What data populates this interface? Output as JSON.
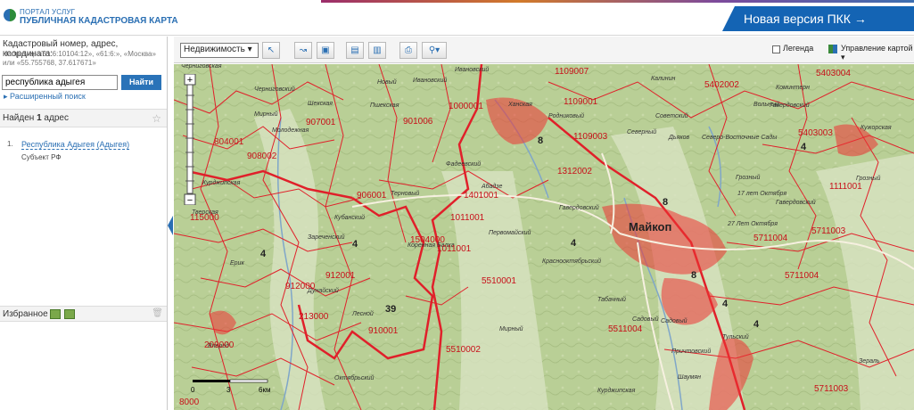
{
  "header": {
    "brand_top": "ПОРТАЛ УСЛУГ",
    "brand_main": "ПУБЛИЧНАЯ КАДАСТРОВАЯ КАРТА",
    "new_version": "Новая версия ПКК →"
  },
  "sidebar": {
    "hint_title": "Кадастровый номер, адрес, координата:",
    "hint_sub": "Например «61:6:10104:12», «61:6:», «Москва» или «55.755768, 37.617671»",
    "search_value": "республика адыгея",
    "search_button": "Найти",
    "advanced": "Расширенный поиск",
    "found_prefix": "Найден ",
    "found_count": "1",
    "found_suffix": " адрес",
    "result_num": "1.",
    "result_link": "Республика Адыгея (Адыгея)",
    "result_type": "Субъект РФ",
    "favorites": "Избранное"
  },
  "toolbar": {
    "select": "Недвижимость",
    "legend": "Легенда",
    "manage": "Управление картой"
  },
  "map": {
    "city": "Майкоп",
    "scale": [
      "0",
      "3",
      "6км"
    ],
    "labels": [
      {
        "t": "Черниговская"
      },
      {
        "t": "Новый"
      },
      {
        "t": "Ивановский"
      },
      {
        "t": "Ивановский"
      },
      {
        "t": "Черниговский"
      },
      {
        "t": "Шекская"
      },
      {
        "t": "Пшекская"
      },
      {
        "t": "Мирный"
      },
      {
        "t": "Молодежная"
      },
      {
        "t": "Ханская"
      },
      {
        "t": "Родниковый"
      },
      {
        "t": "Калинин"
      },
      {
        "t": "Гавердовский"
      },
      {
        "t": "Коминтерн"
      },
      {
        "t": "Вольный"
      },
      {
        "t": "Северный"
      },
      {
        "t": "Советский"
      },
      {
        "t": "Дьяков"
      },
      {
        "t": "Северо-Восточные Сады"
      },
      {
        "t": "Грозный"
      },
      {
        "t": "Фадеевский"
      },
      {
        "t": "Абадзе"
      },
      {
        "t": "Терновый"
      },
      {
        "t": "Кубанский"
      },
      {
        "t": "Гавердовский"
      },
      {
        "t": "Зареченский"
      },
      {
        "t": "Тверская"
      },
      {
        "t": "Курджипская"
      },
      {
        "t": "Коренная Балка"
      },
      {
        "t": "Первомайский"
      },
      {
        "t": "Краснооктябрьский"
      },
      {
        "t": "27 Лет Октября"
      },
      {
        "t": "17 лет Октября"
      },
      {
        "t": "Гавердовский"
      },
      {
        "t": "Ерик"
      },
      {
        "t": "Дунайский"
      },
      {
        "t": "Лесной"
      },
      {
        "t": "Табачный"
      },
      {
        "t": "Мирный"
      },
      {
        "t": "Садовый"
      },
      {
        "t": "Садовый"
      },
      {
        "t": "Тульский"
      },
      {
        "t": "Причтовский"
      },
      {
        "t": "Шаумян"
      },
      {
        "t": "Вперед"
      },
      {
        "t": "Октябрьский"
      },
      {
        "t": "Курджипская"
      },
      {
        "t": "Кужорская"
      },
      {
        "t": "Зераль"
      },
      {
        "t": "Грозный"
      }
    ],
    "parcels": [
      {
        "t": "1109007"
      },
      {
        "t": "5402002"
      },
      {
        "t": "5403004"
      },
      {
        "t": "1109001"
      },
      {
        "t": "1109003"
      },
      {
        "t": "901006"
      },
      {
        "t": "1000001"
      },
      {
        "t": "804001"
      },
      {
        "t": "908002"
      },
      {
        "t": "907001"
      },
      {
        "t": "1312002"
      },
      {
        "t": "5403003"
      },
      {
        "t": "1401001"
      },
      {
        "t": "1111001"
      },
      {
        "t": "906001"
      },
      {
        "t": "1504000"
      },
      {
        "t": "1011001"
      },
      {
        "t": "5711004"
      },
      {
        "t": "5711003"
      },
      {
        "t": "5711004"
      },
      {
        "t": "5510001"
      },
      {
        "t": "912001"
      },
      {
        "t": "912000"
      },
      {
        "t": "213000"
      },
      {
        "t": "209000"
      },
      {
        "t": "910001"
      },
      {
        "t": "5510002"
      },
      {
        "t": "5511004"
      },
      {
        "t": "5711003"
      },
      {
        "t": "1011001"
      },
      {
        "t": "115000"
      },
      {
        "t": "8000"
      },
      {
        "t": "39"
      },
      {
        "t": "8"
      },
      {
        "t": "8"
      },
      {
        "t": "8"
      },
      {
        "t": "4"
      },
      {
        "t": "4"
      },
      {
        "t": "4"
      },
      {
        "t": "4"
      },
      {
        "t": "4"
      },
      {
        "t": "4"
      }
    ]
  }
}
